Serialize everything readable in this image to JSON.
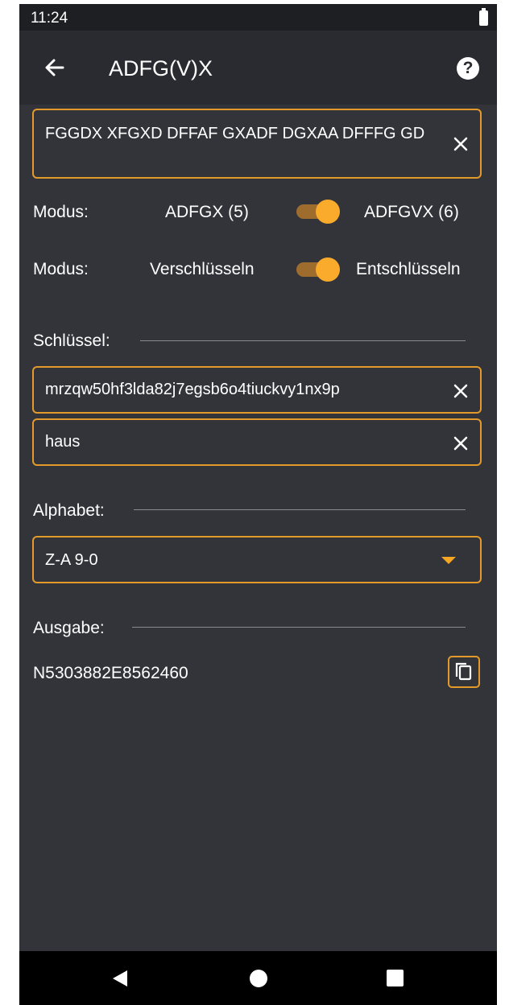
{
  "status_bar": {
    "time": "11:24"
  },
  "app_bar": {
    "title": "ADFG(V)X",
    "back_icon": "arrow-left-icon",
    "help_icon": "question-circle-icon"
  },
  "input": {
    "value": "FGGDX XFGXD DFFAF GXADF DGXAA DFFFG GD",
    "clear_icon": "close-icon"
  },
  "mode_alphabet": {
    "label": "Modus:",
    "left_option": "ADFGX (5)",
    "right_option": "ADFGVX (6)",
    "selected": "right"
  },
  "mode_direction": {
    "label": "Modus:",
    "left_option": "Verschlüsseln",
    "right_option": "Entschlüsseln",
    "selected": "right"
  },
  "key_section": {
    "heading": "Schlüssel:",
    "key1": "mrzqw50hf3lda82j7egsb6o4tiuckvy1nx9p",
    "key2": "haus"
  },
  "alphabet_section": {
    "heading": "Alphabet:",
    "selected": "Z-A 9-0",
    "arrow_icon": "dropdown-arrow-icon"
  },
  "output_section": {
    "heading": "Ausgabe:",
    "value": "N5303882E8562460",
    "copy_icon": "copy-icon"
  },
  "nav_bar": {
    "back_icon": "nav-back-icon",
    "home_icon": "nav-home-icon",
    "recents_icon": "nav-recents-icon"
  },
  "colors": {
    "background": "#33343a",
    "accent": "#f5a623",
    "app_bar": "#2a2b30",
    "status_bar": "#1e1f23"
  }
}
